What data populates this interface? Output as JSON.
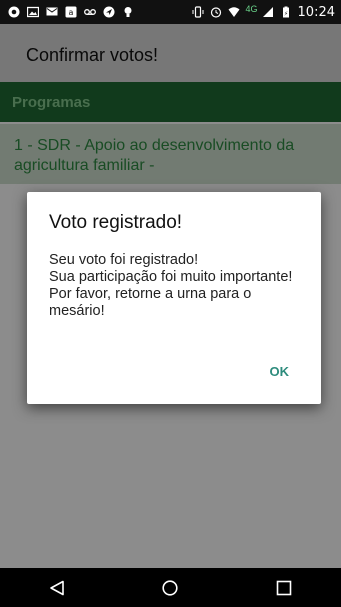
{
  "status_bar": {
    "time": "10:24",
    "network": "4G",
    "left_icons": [
      "app-circle-icon",
      "image-icon",
      "message-icon",
      "amazon-a-icon",
      "voicemail-icon",
      "send-icon",
      "bulb-icon"
    ],
    "right_icons": [
      "vibrate-icon",
      "alarm-icon",
      "wifi-icon",
      "signal-icon",
      "battery-icon"
    ]
  },
  "app_bar": {
    "title": "Confirmar votos!"
  },
  "content": {
    "section_title": "Programas",
    "program_item": "1 - SDR - Apoio ao desenvolvimento da agricultura familiar -"
  },
  "dialog": {
    "title": "Voto registrado!",
    "message": "Seu voto foi registrado!\nSua participação foi muito importante!\nPor favor, retorne a urna para o mesário!",
    "ok_label": "OK"
  },
  "nav_bar": {
    "buttons": [
      "back-icon",
      "home-icon",
      "recents-icon"
    ]
  },
  "colors": {
    "section_header_bg": "#1f6b33",
    "section_header_text": "#86c98e",
    "program_text": "#2e8a42",
    "accent_ok": "#2e8c7d"
  }
}
